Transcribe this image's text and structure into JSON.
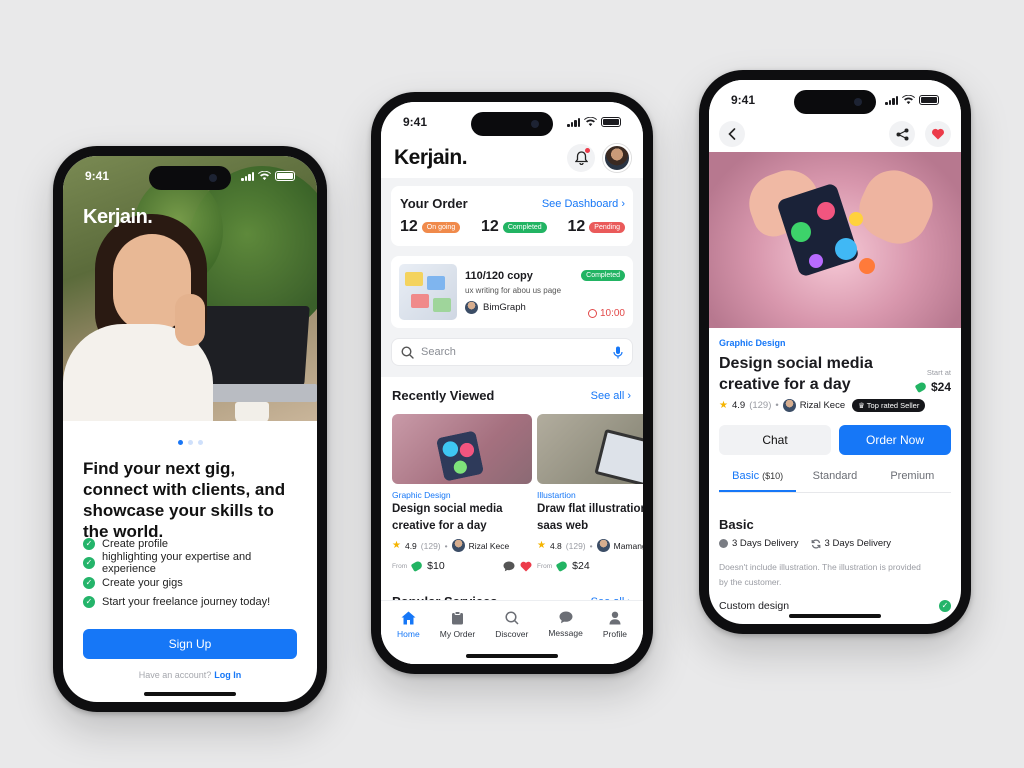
{
  "status": {
    "time": "9:41"
  },
  "onboarding": {
    "brand": "Kerjain.",
    "headline": "Find your next gig, connect with clients, and showcase your skills to the world.",
    "features": [
      "Create profile",
      "highlighting your expertise and experience",
      "Create your gigs",
      "Start your freelance journey today!"
    ],
    "signup_label": "Sign Up",
    "have_account": "Have an account?",
    "login_label": "Log In"
  },
  "home": {
    "brand": "Kerjain.",
    "order": {
      "title": "Your Order",
      "see_dashboard": "See Dashboard",
      "stats": [
        {
          "count": "12",
          "label": "On going",
          "color": "#f08a4b"
        },
        {
          "count": "12",
          "label": "Completed",
          "color": "#22b463"
        },
        {
          "count": "12",
          "label": "Pending",
          "color": "#ea5a5a"
        }
      ]
    },
    "job": {
      "title": "110/120 copy",
      "subtitle": "ux writing for abou us page",
      "client": "BimGraph",
      "status": "Completed",
      "time": "10:00"
    },
    "search_placeholder": "Search",
    "recently_viewed": {
      "title": "Recently Viewed",
      "see_all": "See all",
      "items": [
        {
          "category": "Graphic Design",
          "title_line1": "Design social media",
          "title_line2": "creative for a day",
          "rating": "4.9",
          "reviews": "(129)",
          "seller": "Rizal Kece",
          "from": "From",
          "price": "$10"
        },
        {
          "category": "Illustartion",
          "title_line1": "Draw flat illustration",
          "title_line2": "saas web",
          "rating": "4.8",
          "reviews": "(129)",
          "seller": "Mamang",
          "from": "From",
          "price": "$24"
        }
      ]
    },
    "popular": {
      "title": "Popular Services",
      "see_all": "See all"
    },
    "tabs": [
      "Home",
      "My Order",
      "Discover",
      "Message",
      "Profile"
    ]
  },
  "detail": {
    "category": "Graphic Design",
    "title": "Design social media creative for a day",
    "start_at": "Start at",
    "price": "$24",
    "rating": "4.9",
    "reviews": "(129)",
    "seller": "Rizal Kece",
    "badge": "Top rated Seller",
    "chat_label": "Chat",
    "order_label": "Order Now",
    "packages": [
      {
        "name": "Basic",
        "price": "($10)"
      },
      {
        "name": "Standard",
        "price": ""
      },
      {
        "name": "Premium",
        "price": ""
      }
    ],
    "package_title": "Basic",
    "delivery1": "3 Days Delivery",
    "delivery2": "3 Days Delivery",
    "description": "Doesn't include illustration. The illustration is provided by the customer.",
    "custom_design": "Custom design"
  },
  "colors": {
    "accent": "#1677f7",
    "success": "#22b463",
    "danger": "#ec3b4a"
  }
}
